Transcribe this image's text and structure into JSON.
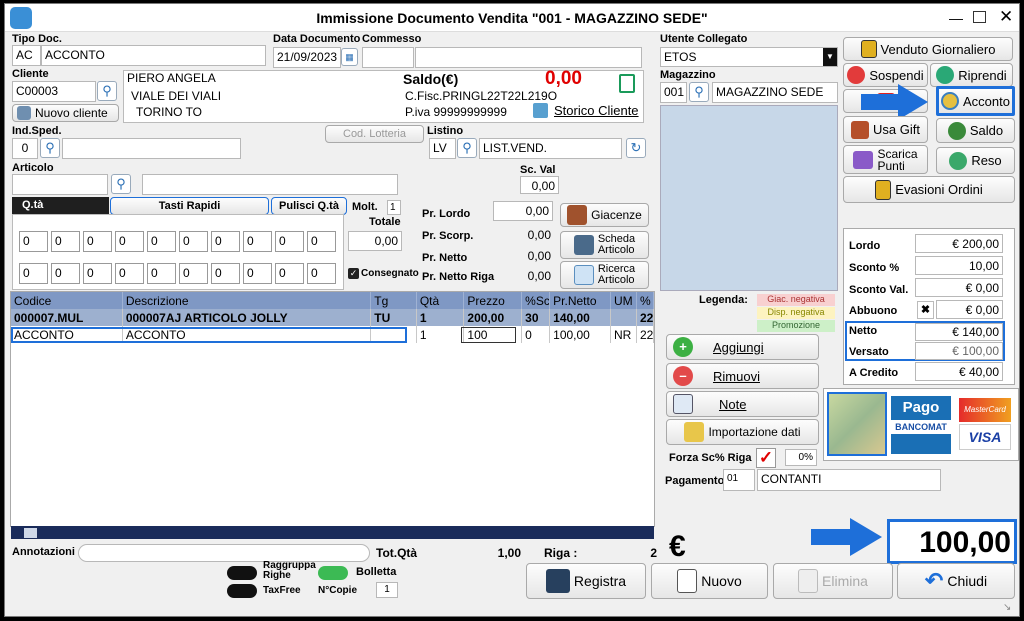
{
  "title": "Immissione Documento Vendita \"001 - MAGAZZINO SEDE\"",
  "header": {
    "tipo_doc_label": "Tipo Doc.",
    "tipo_doc_code": "AC",
    "tipo_doc_desc": "ACCONTO",
    "data_label": "Data Documento",
    "data": "21/09/2023",
    "commesso_label": "Commesso",
    "cliente_label": "Cliente",
    "cliente_code": "C00003",
    "nuovo_cliente": "Nuovo cliente",
    "cliente_nome": "PIERO ANGELA",
    "cliente_via": "VIALE DEI VIALI",
    "cliente_citta": "TORINO TO",
    "saldo_label": "Saldo(€)",
    "saldo_value": "0,00",
    "cfisc": "C.Fisc.PRINGL22T22L219O",
    "piva": "P.iva 99999999999",
    "storico": "Storico Cliente",
    "ind_sped_label": "Ind.Sped.",
    "ind_sped_value": "0",
    "cod_lotteria": "Cod. Lotteria",
    "listino_label": "Listino",
    "listino_code": "LV",
    "listino_desc": "LIST.VEND.",
    "articolo_label": "Articolo",
    "sc_val_label": "Sc. Val",
    "sc_val_value": "0,00"
  },
  "rapidi": {
    "qta_tab": "Q.tà",
    "tasti_rapidi": "Tasti Rapidi",
    "pulisci": "Pulisci Q.tà",
    "molt_label": "Molt.",
    "molt_value": "1",
    "totale_label": "Totale",
    "totale_value": "0,00",
    "consegnato": "Consegnato",
    "row1": [
      "0",
      "0",
      "0",
      "0",
      "0",
      "0",
      "0",
      "0",
      "0",
      "0"
    ],
    "row2": [
      "0",
      "0",
      "0",
      "0",
      "0",
      "0",
      "0",
      "0",
      "0",
      "0"
    ]
  },
  "prices": {
    "lordo_label": "Pr. Lordo",
    "lordo_value": "0,00",
    "scorp_label": "Pr. Scorp.",
    "scorp_value": "0,00",
    "netto_label": "Pr. Netto",
    "netto_value": "0,00",
    "netto_riga_label": "Pr. Netto Riga",
    "netto_riga_value": "0,00",
    "giacenze": "Giacenze",
    "scheda": "Scheda\nArticolo",
    "ricerca": "Ricerca\nArticolo"
  },
  "table": {
    "columns": [
      "Codice",
      "Descrizione",
      "Tg",
      "Qtà",
      "Prezzo",
      "%Sc",
      "Pr.Netto",
      "UM",
      "%"
    ],
    "rows": [
      [
        "000007.MUL",
        "000007AJ ARTICOLO JOLLY",
        "TU",
        "1",
        "200,00",
        "30",
        "140,00",
        "",
        "22"
      ],
      [
        "ACCONTO",
        "ACCONTO",
        "",
        "1",
        "100",
        "0",
        "100,00",
        "NR",
        "22"
      ]
    ]
  },
  "footer": {
    "annotazioni_label": "Annotazioni",
    "tot_qta_label": "Tot.Qtà",
    "tot_qta_value": "1,00",
    "riga_label": "Riga :",
    "riga_value": "2",
    "currency": "€",
    "total": "100,00",
    "raggruppa": "Raggruppa\nRighe",
    "bolletta": "Bolletta",
    "taxfree": "TaxFree",
    "ncopie_label": "N°Copie",
    "ncopie_value": "1",
    "registra": "Registra",
    "nuovo": "Nuovo",
    "elimina": "Elimina",
    "chiudi": "Chiudi"
  },
  "right": {
    "utente_label": "Utente Collegato",
    "utente": "ETOS",
    "magazzino_label": "Magazzino",
    "mag_code": "001",
    "mag_desc": "MAGAZZINO SEDE",
    "legenda_label": "Legenda:",
    "leg1": "Giac. negativa",
    "leg2": "Disp. negativa",
    "leg3": "Promozione",
    "aggiungi": "Aggiungi",
    "rimuovi": "Rimuovi",
    "note": "Note",
    "importazione": "Importazione dati",
    "forza_label": "Forza Sc% Riga",
    "forza_value": "0%",
    "pagamento_label": "Pagamento",
    "pag_code": "01",
    "pag_desc": "CONTANTI",
    "pago_text": "Pago",
    "bancomat_text": "BANCOMAT",
    "visa_text": "VISA",
    "mc_text": "MasterCard"
  },
  "actions": {
    "venduto": "Venduto Giornaliero",
    "sospendi": "Sospendi",
    "riprendi": "Riprendi",
    "acconto": "Acconto",
    "usa_gift": "Usa Gift",
    "saldo": "Saldo",
    "scarica": "Scarica\nPunti",
    "reso": "Reso",
    "evasioni": "Evasioni Ordini"
  },
  "totals": {
    "lordo_label": "Lordo",
    "lordo": "€ 200,00",
    "sconto_pct_label": "Sconto %",
    "sconto_pct": "10,00",
    "sconto_val_label": "Sconto Val.",
    "sconto_val": "€ 0,00",
    "abbuono_label": "Abbuono",
    "abbuono": "€ 0,00",
    "netto_label": "Netto",
    "netto": "€ 140,00",
    "versato_label": "Versato",
    "versato": "€ 100,00",
    "credito_label": "A Credito",
    "credito": "€ 40,00"
  },
  "colors": {
    "accent": "#1e6fd9",
    "saldo_red": "#e00000",
    "grid_header": "#7f98c4",
    "row1": "#9db0cf"
  }
}
